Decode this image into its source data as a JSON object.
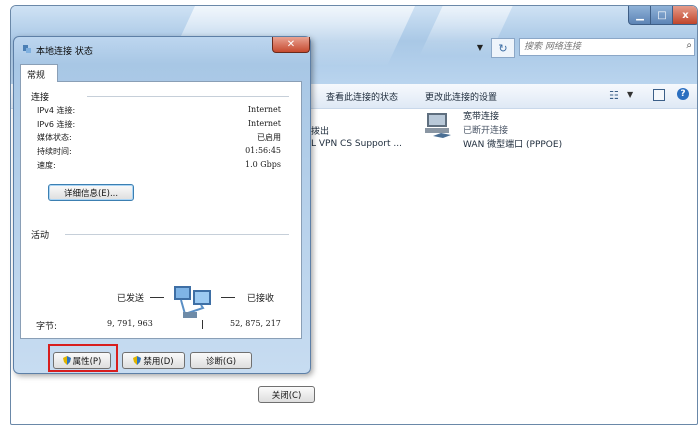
{
  "explorer": {
    "search_placeholder": "搜索 网络连接",
    "commands": {
      "view_status": "查看此连接的状态",
      "change_settings": "更改此连接的设置"
    },
    "connections": [
      {
        "name": "拨出",
        "device": "L VPN CS Support ..."
      },
      {
        "name": "宽带连接",
        "status": "已断开连接",
        "device": "WAN 微型端口 (PPPOE)"
      }
    ]
  },
  "dialog": {
    "title": "本地连接 状态",
    "tab": "常规",
    "connection_group": "连接",
    "rows": [
      {
        "label": "IPv4 连接:",
        "value": "Internet"
      },
      {
        "label": "IPv6 连接:",
        "value": "Internet"
      },
      {
        "label": "媒体状态:",
        "value": "已启用"
      },
      {
        "label": "持续时间:",
        "value": "01:56:45"
      },
      {
        "label": "速度:",
        "value": "1.0 Gbps"
      }
    ],
    "details_button": "详细信息(E)...",
    "activity_group": "活动",
    "sent_label": "已发送",
    "received_label": "已接收",
    "bytes_label": "字节:",
    "bytes_sent": "9, 791, 963",
    "bytes_received": "52, 875, 217",
    "properties_button": "属性(P)",
    "disable_button": "禁用(D)",
    "diagnose_button": "诊断(G)",
    "close_button": "关闭(C)"
  },
  "colors": {
    "highlight": "#d81e1e",
    "title_bar": "#a9c8e6",
    "close_button": "#c64a2f"
  },
  "icons": [
    "search-icon",
    "refresh-icon",
    "broadband-connection-icon",
    "network-activity-icon",
    "shield-icon",
    "close-icon"
  ]
}
